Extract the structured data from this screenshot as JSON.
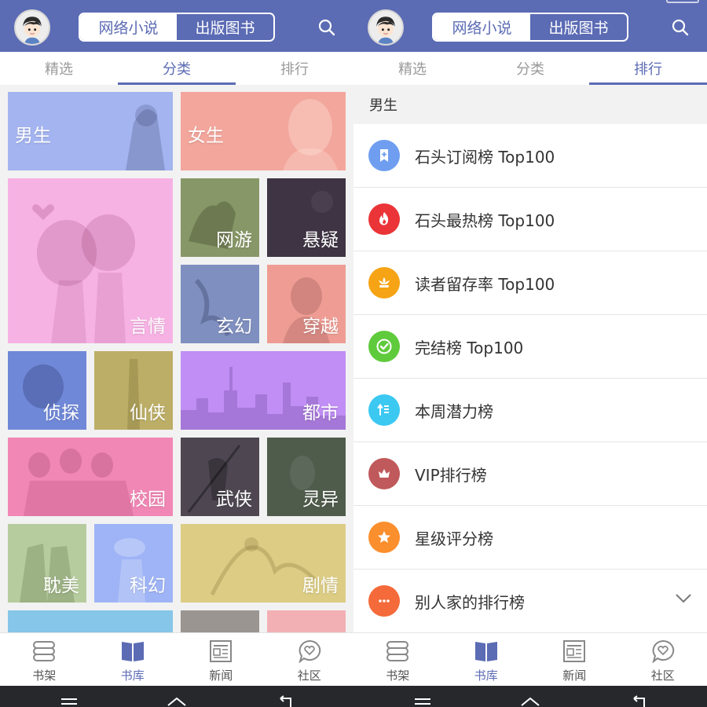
{
  "colors": {
    "brand": "#5b6bb4",
    "divider": "#e6e6e6",
    "background": "#f2f2f2"
  },
  "header": {
    "segment_novels": "网络小说",
    "segment_books": "出版图书",
    "avatar_icon": "avatar-icon",
    "search_icon": "search-icon"
  },
  "tabs": [
    "精选",
    "分类",
    "排行"
  ],
  "left": {
    "active_tab": "分类",
    "categories": [
      {
        "label": "男生",
        "color": "#a4b4f0"
      },
      {
        "label": "女生",
        "color": "#f3a69c"
      },
      {
        "label": "言情",
        "color": "#f7b2e4"
      },
      {
        "label": "网游",
        "color": "#879767"
      },
      {
        "label": "悬疑",
        "color": "#3e3444"
      },
      {
        "label": "玄幻",
        "color": "#7f8fbf"
      },
      {
        "label": "穿越",
        "color": "#ef9d94"
      },
      {
        "label": "侦探",
        "color": "#7088d8"
      },
      {
        "label": "仙侠",
        "color": "#bcae66"
      },
      {
        "label": "都市",
        "color": "#c08ef4"
      },
      {
        "label": "校园",
        "color": "#f187b5"
      },
      {
        "label": "武侠",
        "color": "#4e4752"
      },
      {
        "label": "灵异",
        "color": "#4f5c4c"
      },
      {
        "label": "耽美",
        "color": "#b7cc9e"
      },
      {
        "label": "科幻",
        "color": "#9fb4f6"
      },
      {
        "label": "剧情",
        "color": "#dccc84"
      }
    ],
    "partial_colors": [
      "#86c6e8",
      "#9a9590",
      "#f3b0b4"
    ]
  },
  "right": {
    "active_tab": "排行",
    "section_title": "男生",
    "rankings": [
      {
        "label": "石头订阅榜 Top100",
        "icon": "bookmark-plus-icon",
        "color": "#6f9ef0"
      },
      {
        "label": "石头最热榜 Top100",
        "icon": "flame-icon",
        "color": "#ea3437"
      },
      {
        "label": "读者留存率 Top100",
        "icon": "lotus-icon",
        "color": "#f6a415"
      },
      {
        "label": "完结榜 Top100",
        "icon": "check-circle-icon",
        "color": "#5fcb3c"
      },
      {
        "label": "本周潜力榜",
        "icon": "trend-up-icon",
        "color": "#3bc8f1"
      },
      {
        "label": "VIP排行榜",
        "icon": "crown-icon",
        "color": "#c0595b"
      },
      {
        "label": "星级评分榜",
        "icon": "star-icon",
        "color": "#fb8e2d"
      },
      {
        "label": "别人家的排行榜",
        "icon": "more-dots-icon",
        "color": "#f56a3a",
        "expand_icon": "chevron-down-icon"
      }
    ]
  },
  "bottom_nav": [
    {
      "label": "书架",
      "icon": "bookshelf-icon"
    },
    {
      "label": "书库",
      "icon": "book-icon"
    },
    {
      "label": "新闻",
      "icon": "newspaper-icon"
    },
    {
      "label": "社区",
      "icon": "chat-heart-icon"
    }
  ],
  "active_nav": "书库",
  "system_bar": {
    "buttons": [
      "menu-icon",
      "home-icon",
      "back-icon"
    ]
  }
}
